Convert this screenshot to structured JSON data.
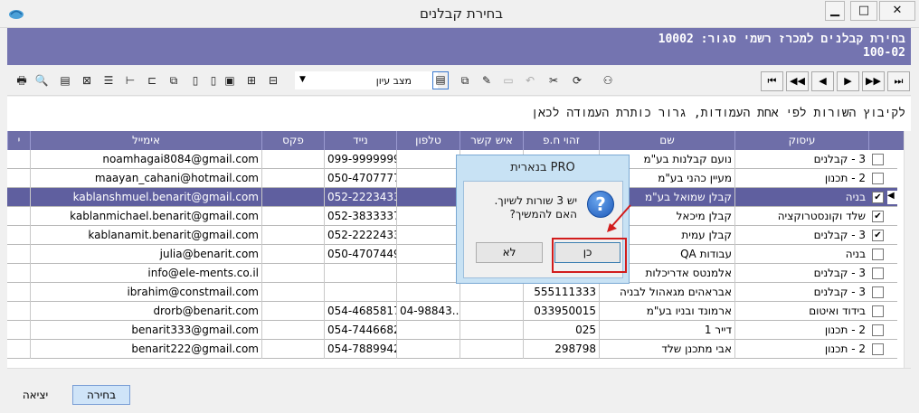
{
  "window": {
    "title": "בחירת קבלנים",
    "minimize": "▁",
    "maximize": "□",
    "close": "✕"
  },
  "header": {
    "line1": "בחירת קבלנים למכרז רשמי סגור: 10002",
    "line2": "100-02"
  },
  "toolbar": {
    "view_label": "מצב עיון"
  },
  "grid": {
    "group_hint": "לקיבוץ השורות לפי אחת העמודות, גרור כותרת העמודה לכאן",
    "columns": {
      "field": "עיסוק",
      "name": "שם",
      "id": "זהוי ח.פ",
      "contact": "איש קשר",
      "phone": "טלפון",
      "mobile": "נייד",
      "fax": "פקס",
      "email": "אימייל",
      "extra": "י"
    },
    "rows": [
      {
        "field": "3 - קבלנים",
        "name": "נועם קבלנות בע\"מ",
        "id": "",
        "contact": "",
        "phone": "",
        "mobile": "099-9999999",
        "fax": "",
        "email": "noamhagai8084@gmail.com",
        "checked": false
      },
      {
        "field": "2 - תכנון",
        "name": "מעיין כהני בע\"מ",
        "id": "",
        "contact": "",
        "phone": "",
        "mobile": "050-4707777",
        "fax": "",
        "email": "maayan_cahani@hotmail.com",
        "checked": false
      },
      {
        "field": "בניה",
        "name": "קבלן שמואל בע\"מ",
        "id": "",
        "contact": "",
        "phone": "",
        "mobile": "052-2223433",
        "fax": "",
        "email": "kablanshmuel.benarit@gmail.com",
        "checked": true,
        "selected": true
      },
      {
        "field": "שלד וקונסטרוקציה",
        "name": "קבלן מיכאל",
        "id": "",
        "contact": "",
        "phone": "",
        "mobile": "052-3833337",
        "fax": "",
        "email": "kablanmichael.benarit@gmail.com",
        "checked": true
      },
      {
        "field": "3 - קבלנים",
        "name": "קבלן עמית",
        "id": "",
        "contact": "",
        "phone": "",
        "mobile": "052-2222433",
        "fax": "",
        "email": "kablanamit.benarit@gmail.com",
        "checked": true
      },
      {
        "field": "בניה",
        "name": "עבודות QA",
        "id": "",
        "contact": "",
        "phone": "",
        "mobile": "050-4707449",
        "fax": "",
        "email": "julia@benarit.com",
        "checked": false
      },
      {
        "field": "3 - קבלנים",
        "name": "אלמנטס אדריכלות",
        "id": "",
        "contact": "",
        "phone": "",
        "mobile": "",
        "fax": "",
        "email": "info@ele-ments.co.il",
        "checked": false
      },
      {
        "field": "3 - קבלנים",
        "name": "אבראהים מגאהול לבניה",
        "id": "555111333",
        "contact": "",
        "phone": "",
        "mobile": "",
        "fax": "",
        "email": "ibrahim@constmail.com",
        "checked": false
      },
      {
        "field": "בידוד ואיטום",
        "name": "ארמונד ובניו בע\"מ",
        "id": "033950015",
        "contact": "",
        "phone": "04-98843...",
        "mobile": "054-4685817",
        "fax": "",
        "email": "drorb@benarit.com",
        "checked": false
      },
      {
        "field": "2 - תכנון",
        "name": "דייר 1",
        "id": "025",
        "contact": "",
        "phone": "",
        "mobile": "054-7446682",
        "fax": "",
        "email": "benarit333@gmail.com",
        "checked": false
      },
      {
        "field": "2 - תכנון",
        "name": "אבי מתכנן שלד",
        "id": "298798",
        "contact": "",
        "phone": "",
        "mobile": "054-7889942",
        "fax": "",
        "email": "benarit222@gmail.com",
        "checked": false
      }
    ]
  },
  "dialog": {
    "title": "בנארית PRO",
    "line1": "יש 3 שורות לשיוך.",
    "line2": "האם להמשיך?",
    "yes": "כן",
    "no": "לא"
  },
  "bottom": {
    "select": "בחירה",
    "exit": "יציאה"
  },
  "colors": {
    "header_band": "#7474b0",
    "grid_header": "#6e6ea8",
    "selected_row": "#5f5f9f",
    "highlight": "#d21c1c"
  }
}
